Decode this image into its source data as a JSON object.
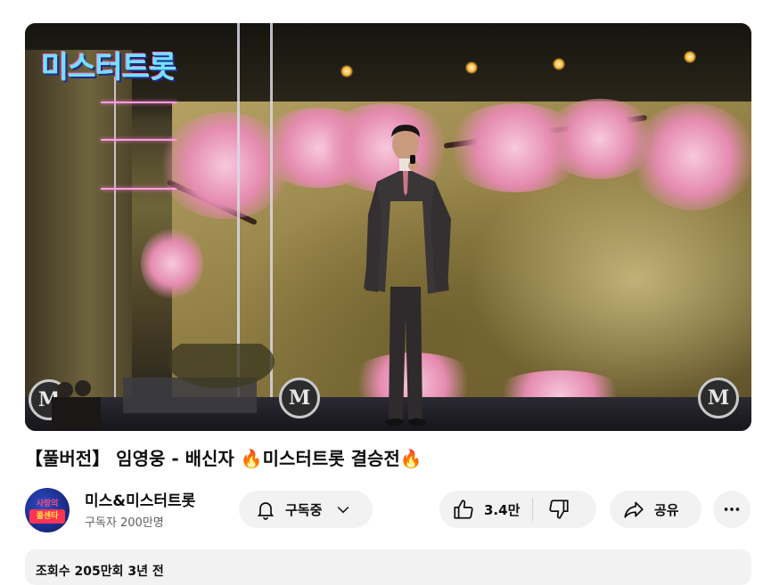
{
  "video": {
    "overlay_logo": "미스터트롯"
  },
  "title": "【풀버전】 임영웅 - 배신자 🔥미스터트롯 결승전🔥",
  "channel": {
    "name": "미스&미스터트롯",
    "subscribers": "구독자 200만명",
    "avatar_text_top": "사랑의",
    "avatar_text_bottom": "콜센타"
  },
  "actions": {
    "subscribe_label": "구독중",
    "like_count": "3.4만",
    "share_label": "공유"
  },
  "description": {
    "stats_line": "조회수 205만회  3년 전"
  },
  "icons": {
    "subscribe": "bell-icon",
    "subscribe_menu": "chevron-down-icon",
    "like": "thumbs-up-icon",
    "dislike": "thumbs-down-icon",
    "share": "share-arrow-icon",
    "more": "more-horizontal-icon"
  }
}
